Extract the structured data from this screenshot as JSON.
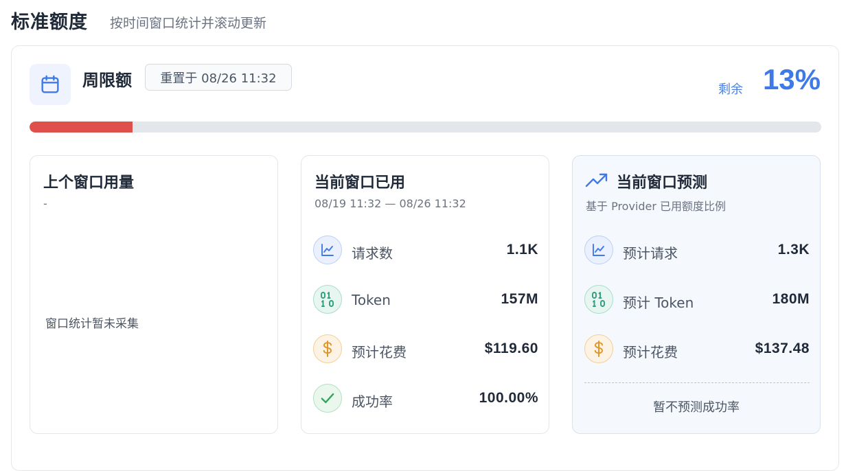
{
  "header": {
    "title": "标准额度",
    "subtitle": "按时间窗口统计并滚动更新"
  },
  "limit": {
    "title": "周限额",
    "reset_badge": "重置于 08/26 11:32",
    "remaining_label": "剩余",
    "remaining_value": "13%",
    "used_fraction": 0.13,
    "icon": "calendar-icon"
  },
  "colors": {
    "accent": "#3f79e8",
    "progress_fill": "#df4f4c",
    "progress_track": "#e3e7ec"
  },
  "prev_window": {
    "title": "上个窗口用量",
    "subtitle": "-",
    "empty_text": "窗口统计暂未采集"
  },
  "current_window": {
    "title": "当前窗口已用",
    "subtitle": "08/19 11:32 — 08/26 11:32",
    "rows": [
      {
        "icon": "line-chart-icon",
        "label": "请求数",
        "value": "1.1K"
      },
      {
        "icon": "binary-icon",
        "label": "Token",
        "value": "157M"
      },
      {
        "icon": "dollar-icon",
        "label": "预计花费",
        "value": "$119.60"
      },
      {
        "icon": "check-icon",
        "label": "成功率",
        "value": "100.00%"
      }
    ]
  },
  "forecast": {
    "title": "当前窗口预测",
    "subtitle": "基于 Provider 已用额度比例",
    "icon": "trending-up-icon",
    "rows": [
      {
        "icon": "line-chart-icon",
        "label": "预计请求",
        "value": "1.3K"
      },
      {
        "icon": "binary-icon",
        "label": "预计 Token",
        "value": "180M"
      },
      {
        "icon": "dollar-icon",
        "label": "预计花费",
        "value": "$137.48"
      }
    ],
    "note": "暂不预测成功率"
  }
}
